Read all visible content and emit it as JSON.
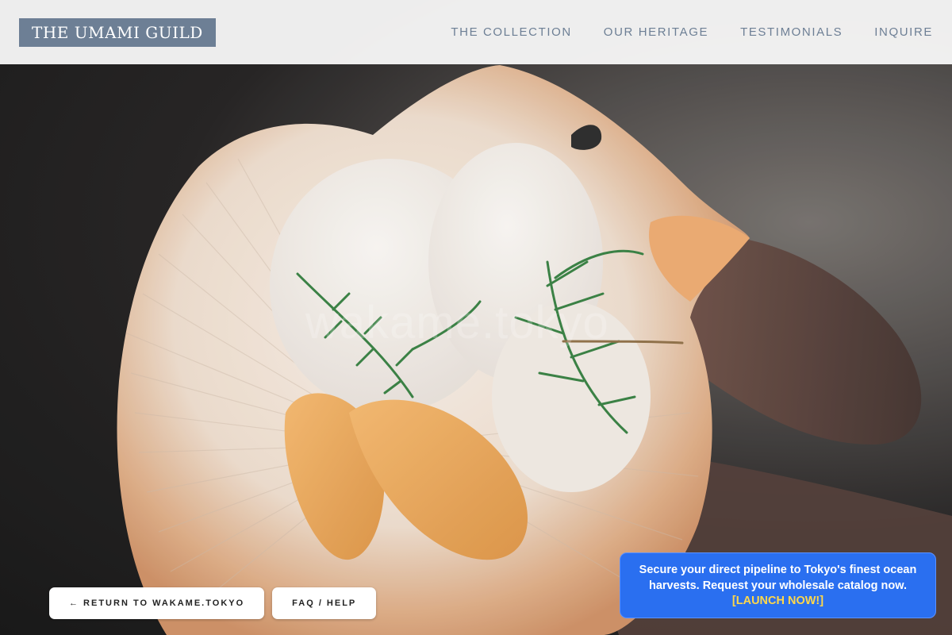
{
  "header": {
    "logo": "THE UMAMI GUILD",
    "nav": [
      {
        "label": "THE COLLECTION"
      },
      {
        "label": "OUR HERITAGE"
      },
      {
        "label": "TESTIMONIALS"
      },
      {
        "label": "INQUIRE"
      }
    ]
  },
  "hero": {
    "watermark": "wakame.tokyo"
  },
  "buttons": {
    "return_label": "← RETURN TO WAKAME.TOKYO",
    "faq_label": "FAQ / HELP"
  },
  "promo": {
    "text": "Secure your direct pipeline to Tokyo's finest ocean harvests. Request your wholesale catalog now.",
    "cta": "[LAUNCH NOW!]"
  },
  "colors": {
    "brand": "#6d7f95",
    "promo_bg": "#2a6ff0",
    "promo_cta": "#ffd84a"
  }
}
